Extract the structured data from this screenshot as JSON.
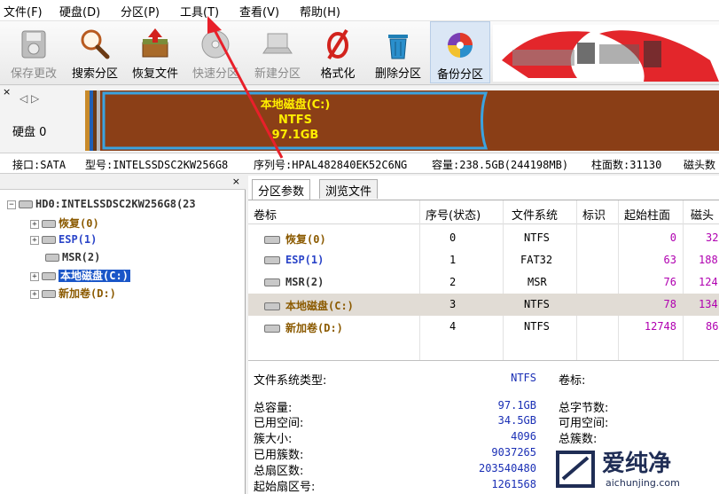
{
  "menu": [
    {
      "label": "文件(F)",
      "key": "file"
    },
    {
      "label": "硬盘(D)",
      "key": "disk"
    },
    {
      "label": "分区(P)",
      "key": "partition"
    },
    {
      "label": "工具(T)",
      "key": "tools"
    },
    {
      "label": "查看(V)",
      "key": "view"
    },
    {
      "label": "帮助(H)",
      "key": "help"
    }
  ],
  "toolbar": {
    "save": "保存更改",
    "search": "搜索分区",
    "recover": "恢复文件",
    "quick": "快速分区",
    "new": "新建分区",
    "format": "格式化",
    "delete": "删除分区",
    "backup": "备份分区"
  },
  "diskpanel": {
    "close": "×",
    "nav": "◁ ▷",
    "disk_label": "硬盘 0",
    "partition_name": "本地磁盘(C:)",
    "partition_fs": "NTFS",
    "partition_size": "97.1GB"
  },
  "infobar": {
    "interface": "接口:SATA",
    "model": "型号:INTELSSDSC2KW256G8",
    "serial": "序列号:HPAL482840EK52C6NG",
    "capacity": "容量:238.5GB(244198MB)",
    "cylinders": "柱面数:31130",
    "heads": "磁头数"
  },
  "tree": {
    "close": "×",
    "root": "HD0:INTELSSDSC2KW256G8(23",
    "items": [
      "恢复(0)",
      "ESP(1)",
      "MSR(2)",
      "本地磁盘(C:)",
      "新加卷(D:)"
    ]
  },
  "tabs": [
    "分区参数",
    "浏览文件"
  ],
  "grid": {
    "headers": [
      "卷标",
      "序号(状态)",
      "文件系统",
      "标识",
      "起始柱面",
      "磁头"
    ],
    "rows": [
      {
        "name": "恢复(0)",
        "idx": "0",
        "fs": "NTFS",
        "start": "0",
        "head": "32"
      },
      {
        "name": "ESP(1)",
        "idx": "1",
        "fs": "FAT32",
        "start": "63",
        "head": "188"
      },
      {
        "name": "MSR(2)",
        "idx": "2",
        "fs": "MSR",
        "start": "76",
        "head": "124"
      },
      {
        "name": "本地磁盘(C:)",
        "idx": "3",
        "fs": "NTFS",
        "start": "78",
        "head": "134"
      },
      {
        "name": "新加卷(D:)",
        "idx": "4",
        "fs": "NTFS",
        "start": "12748",
        "head": "86"
      }
    ]
  },
  "details": {
    "fs_type_label": "文件系统类型:",
    "fs_type_value": "NTFS",
    "volume_label": "卷标:",
    "total_label": "总容量:",
    "total_value": "97.1GB",
    "used_label": "已用空间:",
    "used_value": "34.5GB",
    "cluster_label": "簇大小:",
    "cluster_value": "4096",
    "used_clusters_label": "已用簇数:",
    "used_clusters_value": "9037265",
    "sectors_label": "总扇区数:",
    "sectors_value": "203540480",
    "start_sector_label": "起始扇区号:",
    "start_sector_value": "1261568",
    "total_bytes_label": "总字节数:",
    "free_label": "可用空间:",
    "total_clusters_label": "总簇数:"
  },
  "watermark": {
    "text": "爱纯净",
    "url": "aichunjing.com"
  },
  "colors": {
    "accent": "#1a56c8",
    "partition_brown": "#8b3f17",
    "arrow": "#e8202a"
  }
}
